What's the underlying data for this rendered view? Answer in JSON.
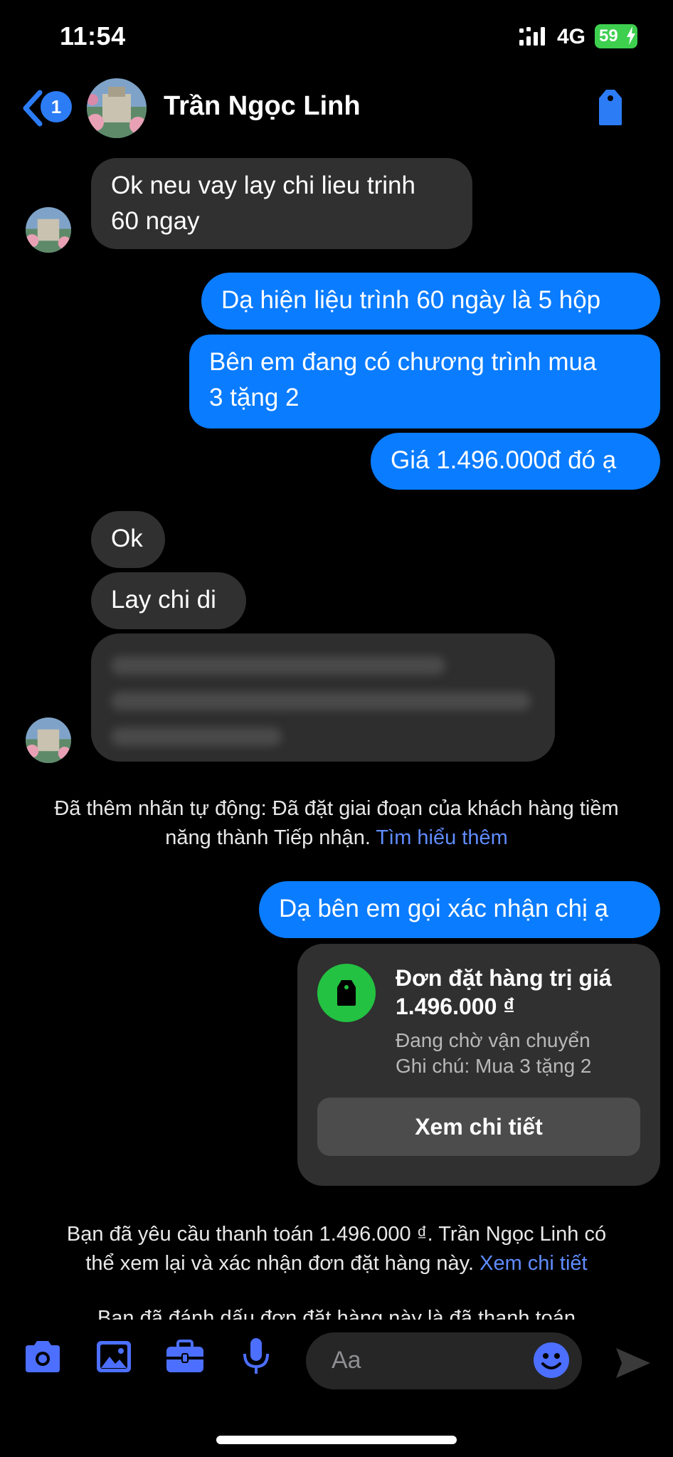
{
  "status_bar": {
    "time": "11:54",
    "network": "4G",
    "battery": "59"
  },
  "header": {
    "contact_name": "Trần Ngọc Linh",
    "unread_badge": "1"
  },
  "messages": {
    "m1_line1": "Ok neu vay lay chi lieu trinh",
    "m1_line2": "60 ngay",
    "m2": "Dạ hiện liệu trình 60 ngày là 5 hộp",
    "m3_line1": "Bên em đang có chương trình mua",
    "m3_line2": "3 tặng 2",
    "m4": "Giá 1.496.000đ đó ạ",
    "m5": "Ok",
    "m6": "Lay chi di",
    "m8": "Dạ bên em gọi xác nhận chị ạ"
  },
  "notice1": {
    "line1": "Đã thêm nhãn tự động: Đã đặt giai đoạn của khách hàng tiềm",
    "line2_text": "năng thành Tiếp nhận.",
    "link": "Tìm hiểu thêm"
  },
  "order": {
    "title_line1": "Đơn đặt hàng trị giá",
    "title_line2": "1.496.000 ₫",
    "status": "Đang chờ vận chuyển",
    "note": "Ghi chú: Mua 3 tặng 2",
    "button": "Xem chi tiết"
  },
  "notice2": {
    "line1": "Bạn đã yêu cầu thanh toán 1.496.000 ₫. Trần Ngọc Linh có",
    "line2_text": "thể xem lại và xác nhận đơn đặt hàng này.",
    "link": "Xem chi tiết"
  },
  "notice3_partial": "Bạn đã đánh dấu đơn đặt hàng này là đã thanh toán",
  "composer": {
    "placeholder": "Aa"
  },
  "colors": {
    "accent": "#0a7cff",
    "incoming": "#303030",
    "link": "#5f8cff",
    "order_icon": "#23c242"
  }
}
